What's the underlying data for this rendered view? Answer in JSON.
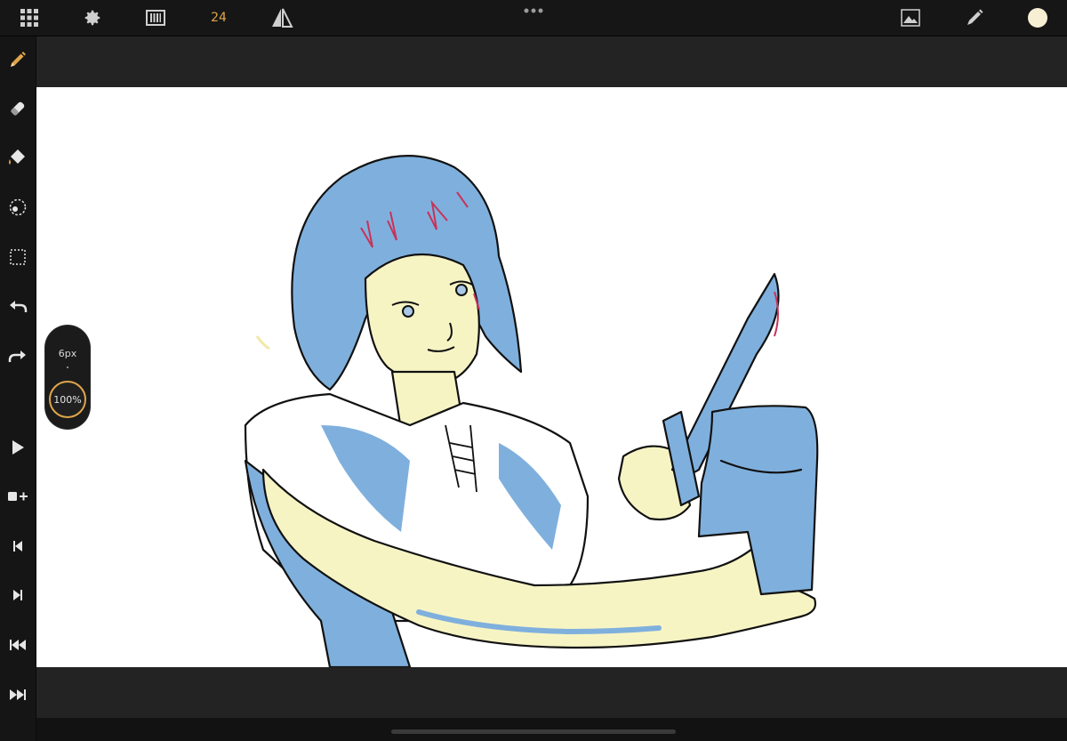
{
  "topbar": {
    "fps": "24",
    "color_swatch": "#f7efd4",
    "icons": [
      "grid-icon",
      "gear-icon",
      "film-strip-icon",
      "flip-icon",
      "more-icon",
      "image-icon",
      "pencil-icon"
    ]
  },
  "sidebar": {
    "tools": [
      "pencil-tool",
      "eraser-tool",
      "fill-tool",
      "lasso-tool",
      "selection-tool",
      "undo",
      "redo"
    ],
    "playback": [
      "play",
      "add-frame",
      "previous-frame",
      "next-frame",
      "first-frame",
      "last-frame"
    ]
  },
  "brush": {
    "size_label": "6px",
    "opacity_label": "100%"
  },
  "colors": {
    "accent": "#e0a64a",
    "fill_blue": "#7fb0dd",
    "fill_yellow": "#f7f4c4",
    "line": "#111111",
    "accent_pink": "#c8325a"
  }
}
